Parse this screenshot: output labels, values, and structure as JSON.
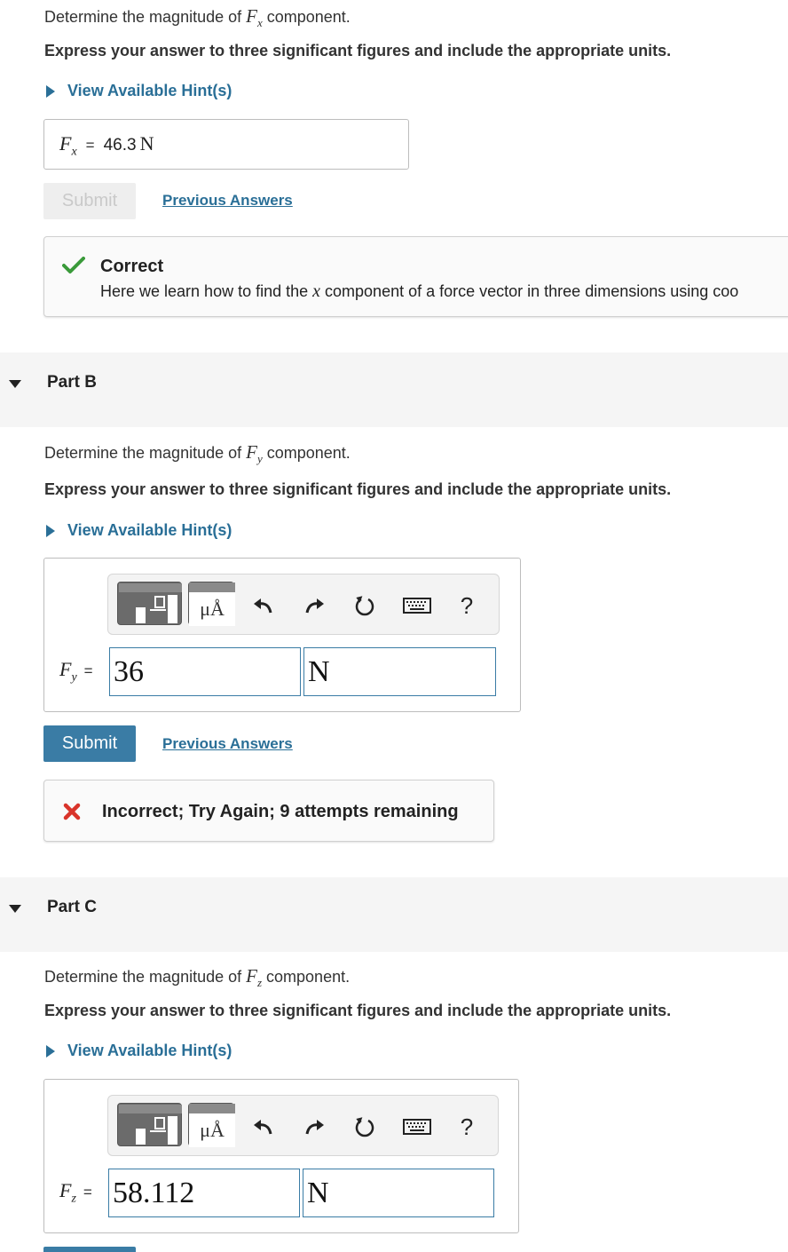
{
  "part_a": {
    "question_prefix": "Determine the magnitude of ",
    "var_main": "F",
    "var_sub": "x",
    "question_suffix": " component.",
    "instructions": "Express your answer to three significant figures and include the appropriate units.",
    "hint_label": "View Available Hint(s)",
    "answer_var": "F",
    "answer_sub": "x",
    "equals": "=",
    "answer_value": "46.3",
    "answer_unit": "N",
    "submit_label": "Submit",
    "previous_label": "Previous Answers",
    "feedback_title": "Correct",
    "feedback_text_prefix": "Here we learn how to find the ",
    "feedback_text_var": "x",
    "feedback_text_suffix": " component of a force vector in three dimensions using coo"
  },
  "part_b": {
    "title": "Part B",
    "question_prefix": "Determine the magnitude of ",
    "var_main": "F",
    "var_sub": "y",
    "question_suffix": " component.",
    "instructions": "Express your answer to three significant figures and include the appropriate units.",
    "hint_label": "View Available Hint(s)",
    "answer_var": "F",
    "answer_sub": "y",
    "equals": "=",
    "value_input": "36",
    "unit_input": "N",
    "help_label": "?",
    "unit_button_label": "μÅ",
    "submit_label": "Submit",
    "previous_label": "Previous Answers",
    "feedback_text": "Incorrect; Try Again; 9 attempts remaining"
  },
  "part_c": {
    "title": "Part C",
    "question_prefix": "Determine the magnitude of ",
    "var_main": "F",
    "var_sub": "z",
    "question_suffix": " component.",
    "instructions": "Express your answer to three significant figures and include the appropriate units.",
    "hint_label": "View Available Hint(s)",
    "answer_var": "F",
    "answer_sub": "z",
    "equals": "=",
    "value_input": "58.112",
    "unit_input": "N",
    "help_label": "?",
    "unit_button_label": "μÅ"
  },
  "colors": {
    "link": "#2a6f97",
    "submit": "#3a7ca5",
    "correct": "#3a9a3a",
    "incorrect": "#d9342b",
    "band": "#f5f5f5"
  }
}
